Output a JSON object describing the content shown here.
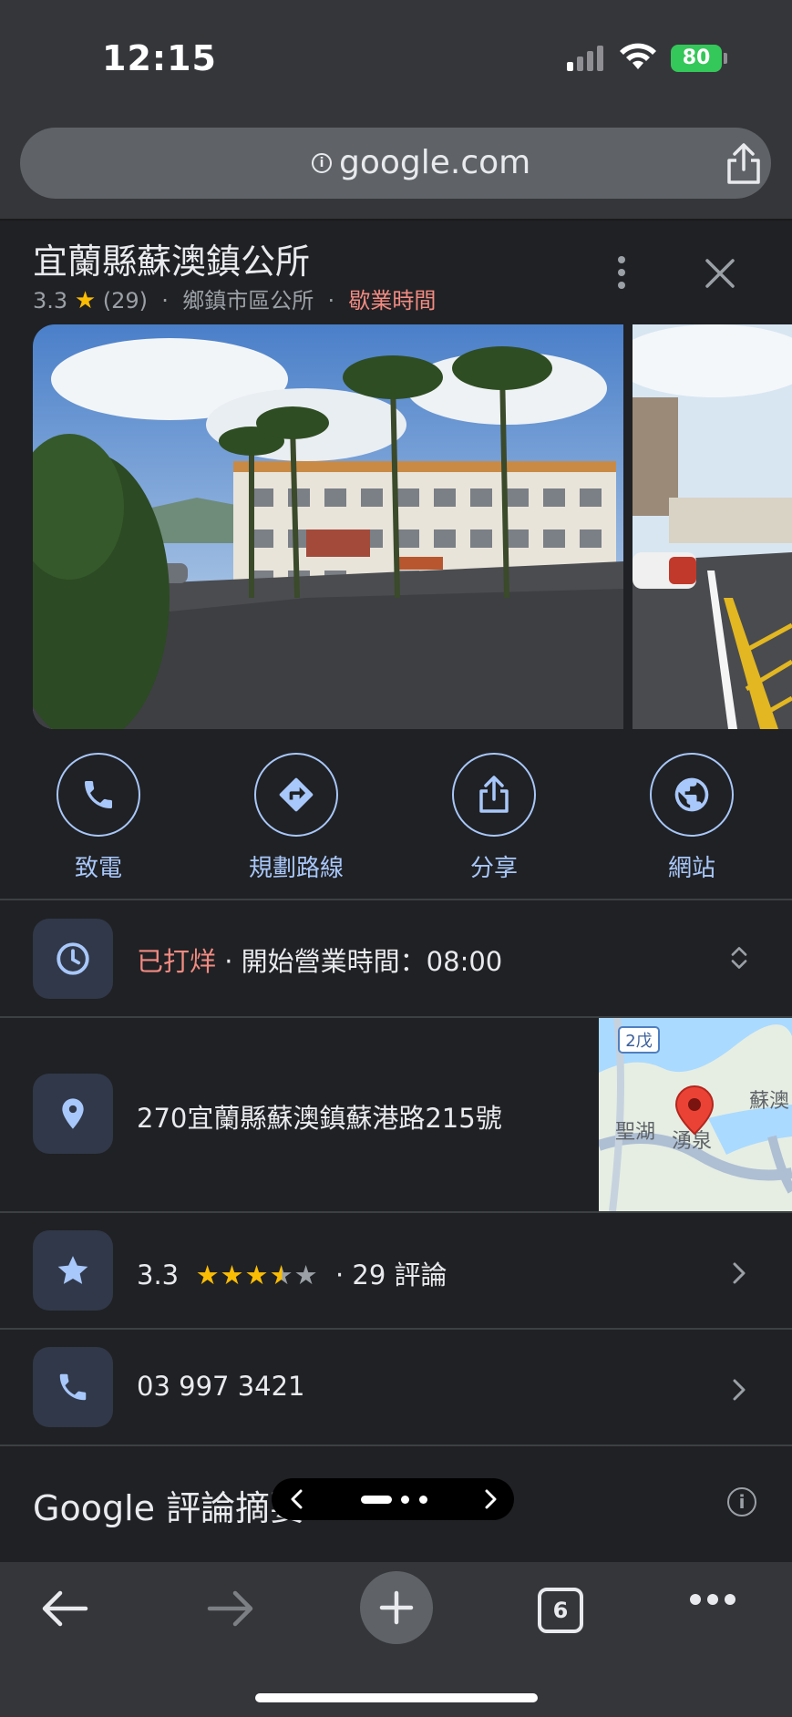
{
  "status_bar": {
    "time": "12:15",
    "battery": "80"
  },
  "browser": {
    "url": "google.com",
    "info_icon": "i",
    "tab_count": "6"
  },
  "place": {
    "name": "宜蘭縣蘇澳鎮公所",
    "rating": "3.3",
    "star_glyph": "★",
    "review_count": "(29)",
    "separator": "·",
    "category": "鄉鎮市區公所",
    "hours_link": "歇業時間"
  },
  "actions": [
    {
      "label": "致電",
      "icon": "phone-icon"
    },
    {
      "label": "規劃路線",
      "icon": "directions-icon"
    },
    {
      "label": "分享",
      "icon": "share-icon"
    },
    {
      "label": "網站",
      "icon": "globe-icon"
    }
  ],
  "hours": {
    "status": "已打烊",
    "detail": " · 開始營業時間：08:00"
  },
  "address": {
    "text": "270宜蘭縣蘇澳鎮蘇港路215號"
  },
  "map": {
    "route_badge": "2戊",
    "labels": [
      "聖湖",
      "湧泉",
      "蘇澳"
    ]
  },
  "rating_row": {
    "value": "3.3",
    "stars_filled": "★★★",
    "star_half": "★",
    "star_empty": "★",
    "reviews": "· 29 評論",
    "rating_value": 3.3
  },
  "phone": {
    "number": "03 997 3421"
  },
  "reviews_summary": {
    "title": "Google 評論摘要",
    "info_icon": "i"
  },
  "colors": {
    "accent": "#a8c7fa",
    "closed": "#f28b82",
    "star": "#fbbc04",
    "battery": "#34c759",
    "pin": "#ea4335"
  }
}
